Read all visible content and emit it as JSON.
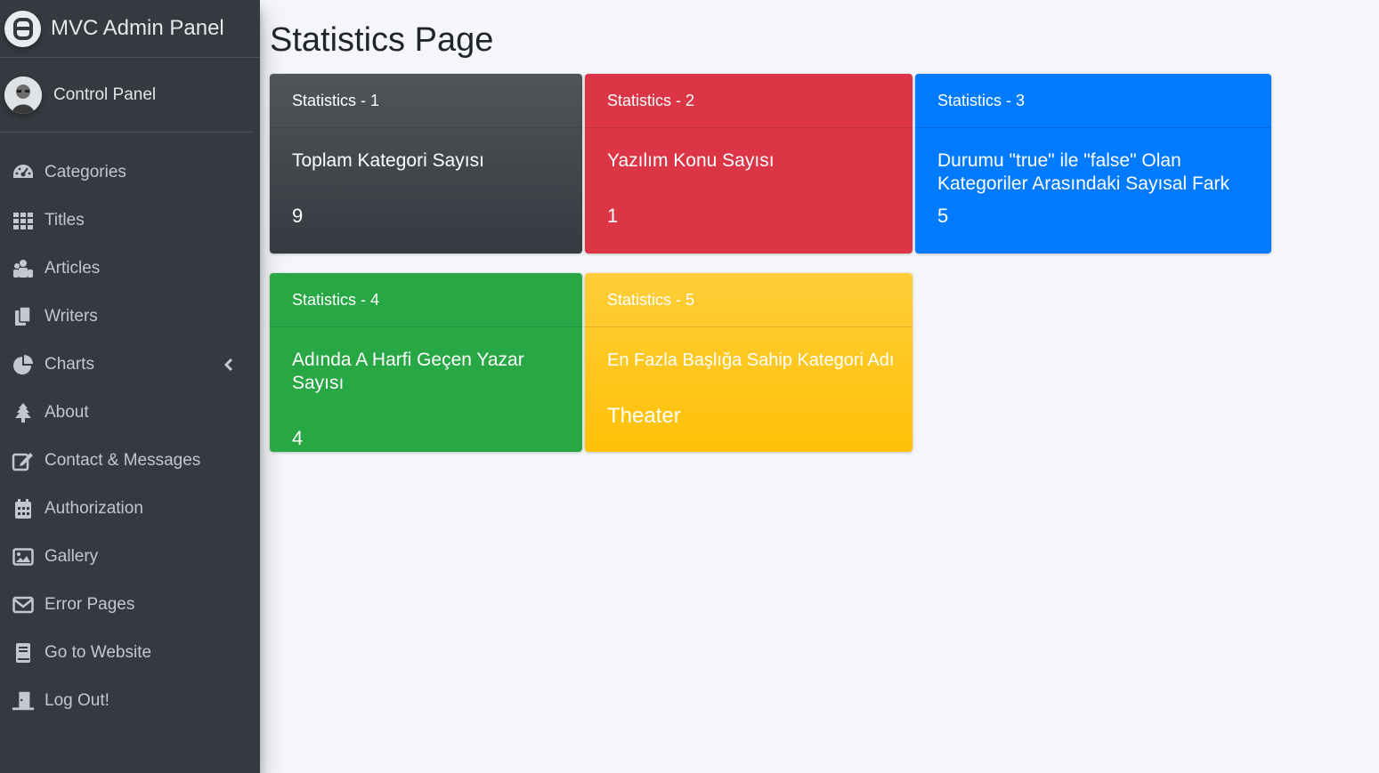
{
  "brand": {
    "title": "MVC Admin Panel"
  },
  "user": {
    "name": "Control Panel"
  },
  "sidebar": {
    "items": [
      {
        "label": "Categories",
        "icon": "tachometer-icon"
      },
      {
        "label": "Titles",
        "icon": "grid-icon"
      },
      {
        "label": "Articles",
        "icon": "users-icon"
      },
      {
        "label": "Writers",
        "icon": "copy-icon"
      },
      {
        "label": "Charts",
        "icon": "pie-chart-icon"
      },
      {
        "label": "About",
        "icon": "tree-icon"
      },
      {
        "label": "Contact & Messages",
        "icon": "edit-icon"
      },
      {
        "label": "Authorization",
        "icon": "calendar-icon"
      },
      {
        "label": "Gallery",
        "icon": "image-icon"
      },
      {
        "label": "Error Pages",
        "icon": "envelope-icon"
      },
      {
        "label": "Go to Website",
        "icon": "book-icon"
      },
      {
        "label": "Log Out!",
        "icon": "door-icon"
      }
    ]
  },
  "main": {
    "title": "Statistics Page",
    "cards": [
      {
        "header": "Statistics - 1",
        "text": "Toplam Kategori Sayısı",
        "value": "9",
        "color": "#343a40"
      },
      {
        "header": "Statistics - 2",
        "text": "Yazılım Konu Sayısı",
        "value": "1",
        "color": "#dc3545"
      },
      {
        "header": "Statistics - 3",
        "text": "Durumu \"true\" ile \"false\" Olan Kategoriler Arasındaki Sayısal Fark",
        "value": "5",
        "color": "#007bff"
      },
      {
        "header": "Statistics - 4",
        "text": "Adında A Harfi Geçen Yazar Sayısı",
        "value": "4",
        "color": "#28a745"
      },
      {
        "header": "Statistics - 5",
        "text": "En Fazla Başlığa Sahip Kategori Adı",
        "value": "Theater",
        "color": "#ffc107"
      }
    ]
  }
}
